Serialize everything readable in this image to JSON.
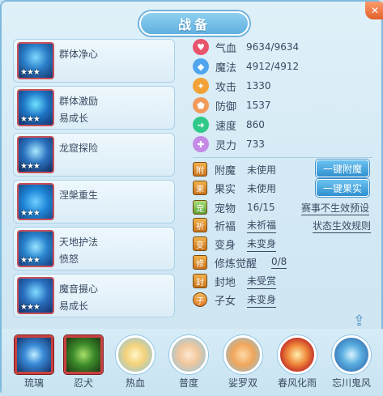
{
  "title": "战备",
  "skills": [
    {
      "name": "群体净心",
      "sub": "",
      "stars": "★★★"
    },
    {
      "name": "群体激励",
      "sub": "易成长",
      "stars": "★★★"
    },
    {
      "name": "龙窟探险",
      "sub": "",
      "stars": "★★★"
    },
    {
      "name": "涅槃重生",
      "sub": "",
      "stars": "★★★"
    },
    {
      "name": "天地护法",
      "sub": "愤怒",
      "stars": "★★★"
    },
    {
      "name": "魔音摄心",
      "sub": "易成长",
      "stars": "★★★"
    }
  ],
  "stats": [
    {
      "label": "气血",
      "value": "9634/9634",
      "color": "#e8556b",
      "icon": "heart-icon"
    },
    {
      "label": "魔法",
      "value": "4912/4912",
      "color": "#4fa6ef",
      "icon": "mana-icon"
    },
    {
      "label": "攻击",
      "value": "1330",
      "color": "#f2a236",
      "icon": "attack-icon"
    },
    {
      "label": "防御",
      "value": "1537",
      "color": "#f29a5a",
      "icon": "defense-icon"
    },
    {
      "label": "速度",
      "value": "860",
      "color": "#2fc98a",
      "icon": "speed-icon"
    },
    {
      "label": "灵力",
      "value": "733",
      "color": "#c58ae6",
      "icon": "spirit-icon"
    }
  ],
  "info": {
    "enchant": {
      "label": "附魔",
      "value": "未使用",
      "button": "一键附魔"
    },
    "fruit": {
      "label": "果实",
      "value": "未使用",
      "button": "一键果实"
    },
    "pet": {
      "label": "宠物",
      "value": "16/15",
      "link": "赛事不生效预设"
    },
    "blessing": {
      "label": "祈福",
      "value": "未祈福",
      "link": "状态生效规则"
    },
    "transform": {
      "label": "变身",
      "value": "未变身"
    },
    "cultivation": {
      "label": "修炼觉醒",
      "value": "0/8"
    },
    "fief": {
      "label": "封地",
      "value": "未受赏"
    },
    "children": {
      "label": "子女",
      "value": "未变身"
    }
  },
  "bottom": [
    {
      "label": "琉璃",
      "selected": true
    },
    {
      "label": "忍犬",
      "selected": true
    },
    {
      "label": "热血",
      "selected": false
    },
    {
      "label": "普度",
      "selected": false
    },
    {
      "label": "娑罗双",
      "selected": false
    },
    {
      "label": "春风化雨",
      "selected": false
    },
    {
      "label": "忘川鬼风",
      "selected": false
    }
  ]
}
